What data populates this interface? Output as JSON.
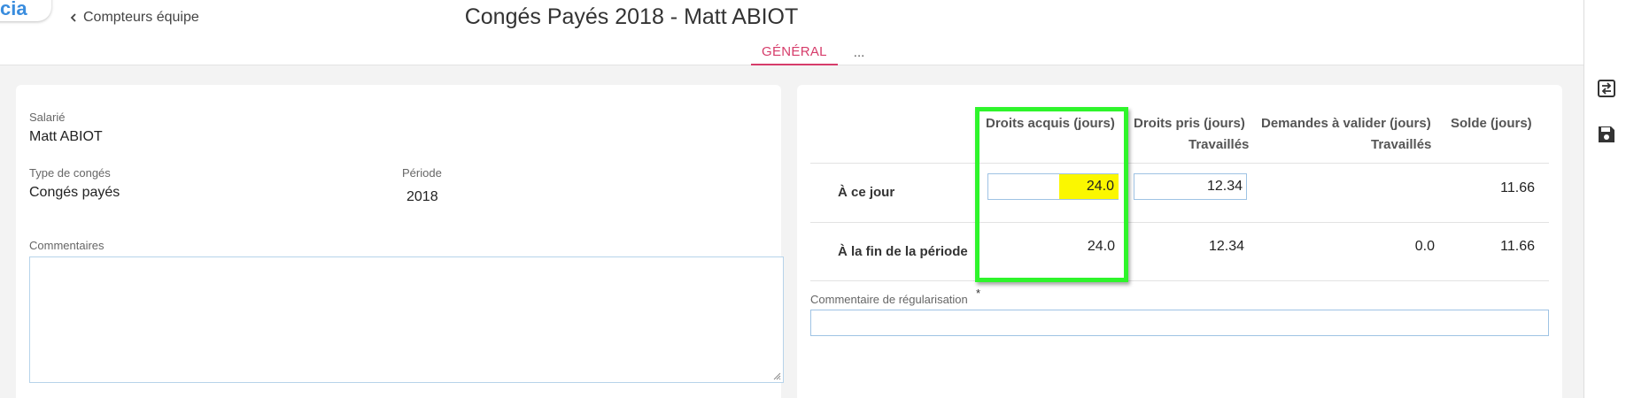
{
  "header": {
    "logo_text": "cia",
    "back_label": "Compteurs équipe",
    "title": "Congés Payés 2018 - Matt ABIOT",
    "tabs": [
      {
        "label": "GÉNÉRAL",
        "active": true
      },
      {
        "label": "..."
      }
    ]
  },
  "form": {
    "employee_label": "Salarié",
    "employee_value": "Matt ABIOT",
    "leave_type_label": "Type de congés",
    "leave_type_value": "Congés payés",
    "period_label": "Période",
    "period_value": "2018",
    "comments_label": "Commentaires",
    "comments_value": ""
  },
  "balances": {
    "columns": [
      {
        "label": "Droits acquis (jours)",
        "sub": ""
      },
      {
        "label": "Droits pris (jours)",
        "sub": "Travaillés"
      },
      {
        "label": "Demandes à valider (jours)",
        "sub": "Travaillés"
      },
      {
        "label": "Solde (jours)",
        "sub": ""
      }
    ],
    "rows": [
      {
        "label": "À ce jour",
        "acquired": "24.0",
        "taken": "12.34",
        "pending": "",
        "balance": "11.66"
      },
      {
        "label": "À la fin de la période",
        "acquired": "24.0",
        "taken": "12.34",
        "pending": "0.0",
        "balance": "11.66"
      }
    ],
    "regularization_label": "Commentaire de régularisation",
    "regularization_required": "*",
    "regularization_value": ""
  },
  "toolbar": {
    "icons": [
      "swap-icon",
      "save-icon"
    ]
  },
  "colors": {
    "accent": "#d63c6a",
    "highlight": "#fbf700",
    "annotation": "#2ef52b",
    "input_border": "#9fc3e4"
  }
}
